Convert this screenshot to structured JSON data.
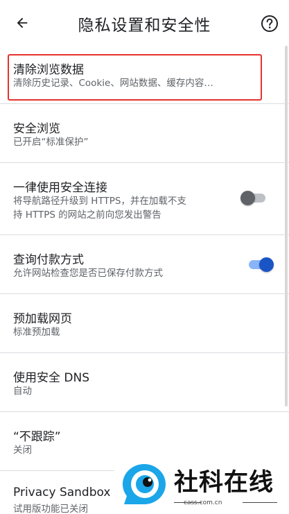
{
  "header": {
    "title": "隐私设置和安全性",
    "back_icon": "arrow-left-icon",
    "help_icon": "question-circle-icon"
  },
  "items": [
    {
      "title": "清除浏览数据",
      "subtitle": "清除历史记录、Cookie、网站数据、缓存内容…"
    },
    {
      "title": "安全浏览",
      "subtitle": "已开启“标准保护”"
    },
    {
      "title": "一律使用安全连接",
      "subtitle_lines": [
        "将导航路径升级到 HTTPS，并在加载不支",
        "持 HTTPS 的网站之前向您发出警告"
      ],
      "toggle": false
    },
    {
      "title": "查询付款方式",
      "subtitle": "允许网站检查您是否已保存付款方式",
      "toggle": true
    },
    {
      "title": "预加载网页",
      "subtitle": "标准预加载"
    },
    {
      "title": "使用安全 DNS",
      "subtitle": "自动"
    },
    {
      "title": "“不跟踪”",
      "subtitle": "关闭"
    },
    {
      "title": "Privacy Sandbox",
      "subtitle": "试用版功能已关闭"
    }
  ],
  "watermark": {
    "text": "社科在线",
    "url": "cass.com.cn"
  },
  "colors": {
    "highlight_border": "#e5322d",
    "toggle_on": "#1a55c5",
    "toggle_off": "#5f6368"
  }
}
